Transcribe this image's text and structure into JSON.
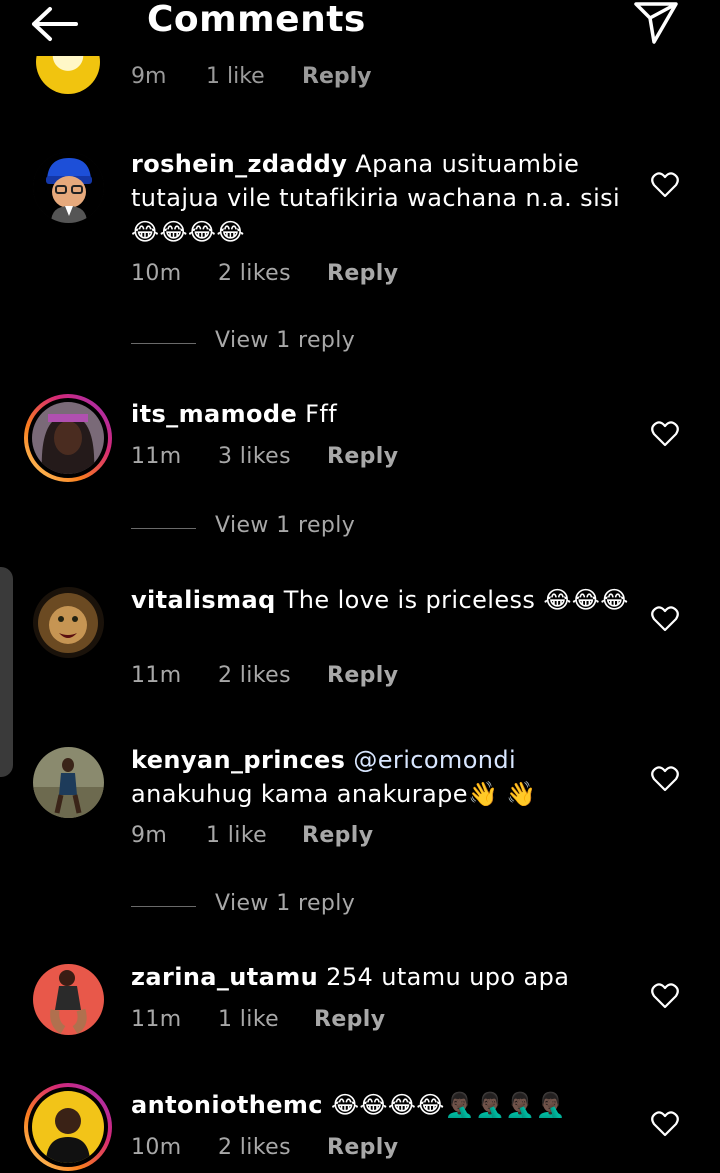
{
  "header": {
    "title": "Comments"
  },
  "partial": {
    "time": "9m",
    "likes": "1 like",
    "reply": "Reply"
  },
  "comments": [
    {
      "user": "roshein_zdaddy",
      "text": " Apana usituambie tutajua vile tutafikiria wachana n.a. sisi 😂😂😂😂",
      "time": "10m",
      "likes": "2 likes",
      "reply": "Reply",
      "view_replies": "View 1 reply"
    },
    {
      "user": "its_mamode",
      "text": " Fff",
      "time": "11m",
      "likes": "3 likes",
      "reply": "Reply",
      "view_replies": "View 1 reply"
    },
    {
      "user": "vitalismaq",
      "text": " The love is priceless 😂😂😂",
      "time": "11m",
      "likes": "2 likes",
      "reply": "Reply"
    },
    {
      "user": "kenyan_princes",
      "mention": " @ericomondi",
      "text": " anakuhug kama anakurape👋 👋",
      "time": "9m",
      "likes": "1 like",
      "reply": "Reply",
      "view_replies": "View 1 reply"
    },
    {
      "user": "zarina_utamu",
      "text": " 254 utamu upo apa",
      "time": "11m",
      "likes": "1 like",
      "reply": "Reply"
    },
    {
      "user": "antoniothemc",
      "text": " 😂😂😂😂🤦🏿‍♂️🤦🏿‍♂️🤦🏿‍♂️🤦🏿‍♂️",
      "time": "10m",
      "likes": "2 likes",
      "reply": "Reply"
    }
  ]
}
